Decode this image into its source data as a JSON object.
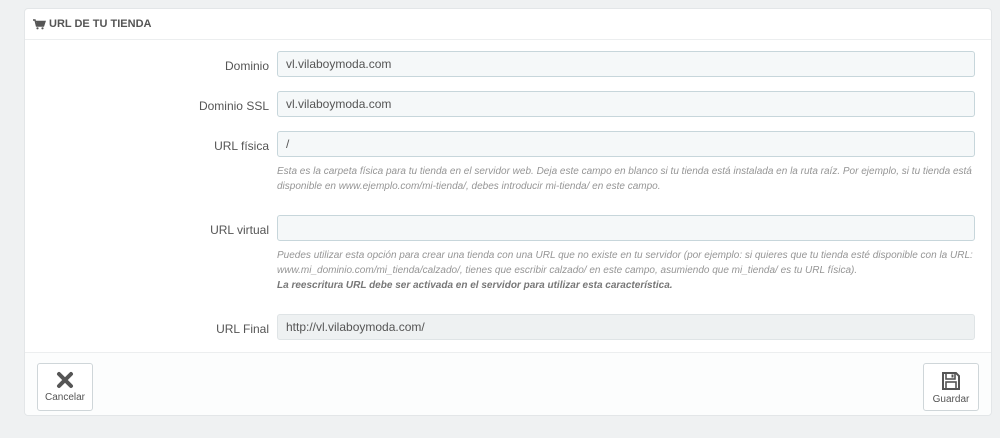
{
  "panel": {
    "title": "URL DE TU TIENDA",
    "icon": "shopping-cart-icon"
  },
  "fields": {
    "dominio": {
      "label": "Dominio",
      "value": "vl.vilaboymoda.com"
    },
    "dominio_ssl": {
      "label": "Dominio SSL",
      "value": "vl.vilaboymoda.com"
    },
    "url_fisica": {
      "label": "URL física",
      "value": "/",
      "help": "Esta es la carpeta física para tu tienda en el servidor web. Deja este campo en blanco si tu tienda está instalada en la ruta raíz. Por ejemplo, si tu tienda está disponible en www.ejemplo.com/mi-tienda/, debes introducir mi-tienda/ en este campo."
    },
    "url_virtual": {
      "label": "URL virtual",
      "value": "",
      "help": "Puedes utilizar esta opción para crear una tienda con una URL que no existe en tu servidor (por ejemplo: si quieres que tu tienda esté disponible con la URL: www.mi_dominio.com/mi_tienda/calzado/, tienes que escribir calzado/ en este campo, asumiendo que mi_tienda/ es tu URL física).",
      "help_strong": "La reescritura URL debe ser activada en el servidor para utilizar esta característica."
    },
    "url_final": {
      "label": "URL Final",
      "value": "http://vl.vilaboymoda.com/"
    }
  },
  "footer": {
    "cancel_label": "Cancelar",
    "cancel_icon": "close-icon",
    "save_label": "Guardar",
    "save_icon": "save-icon"
  }
}
